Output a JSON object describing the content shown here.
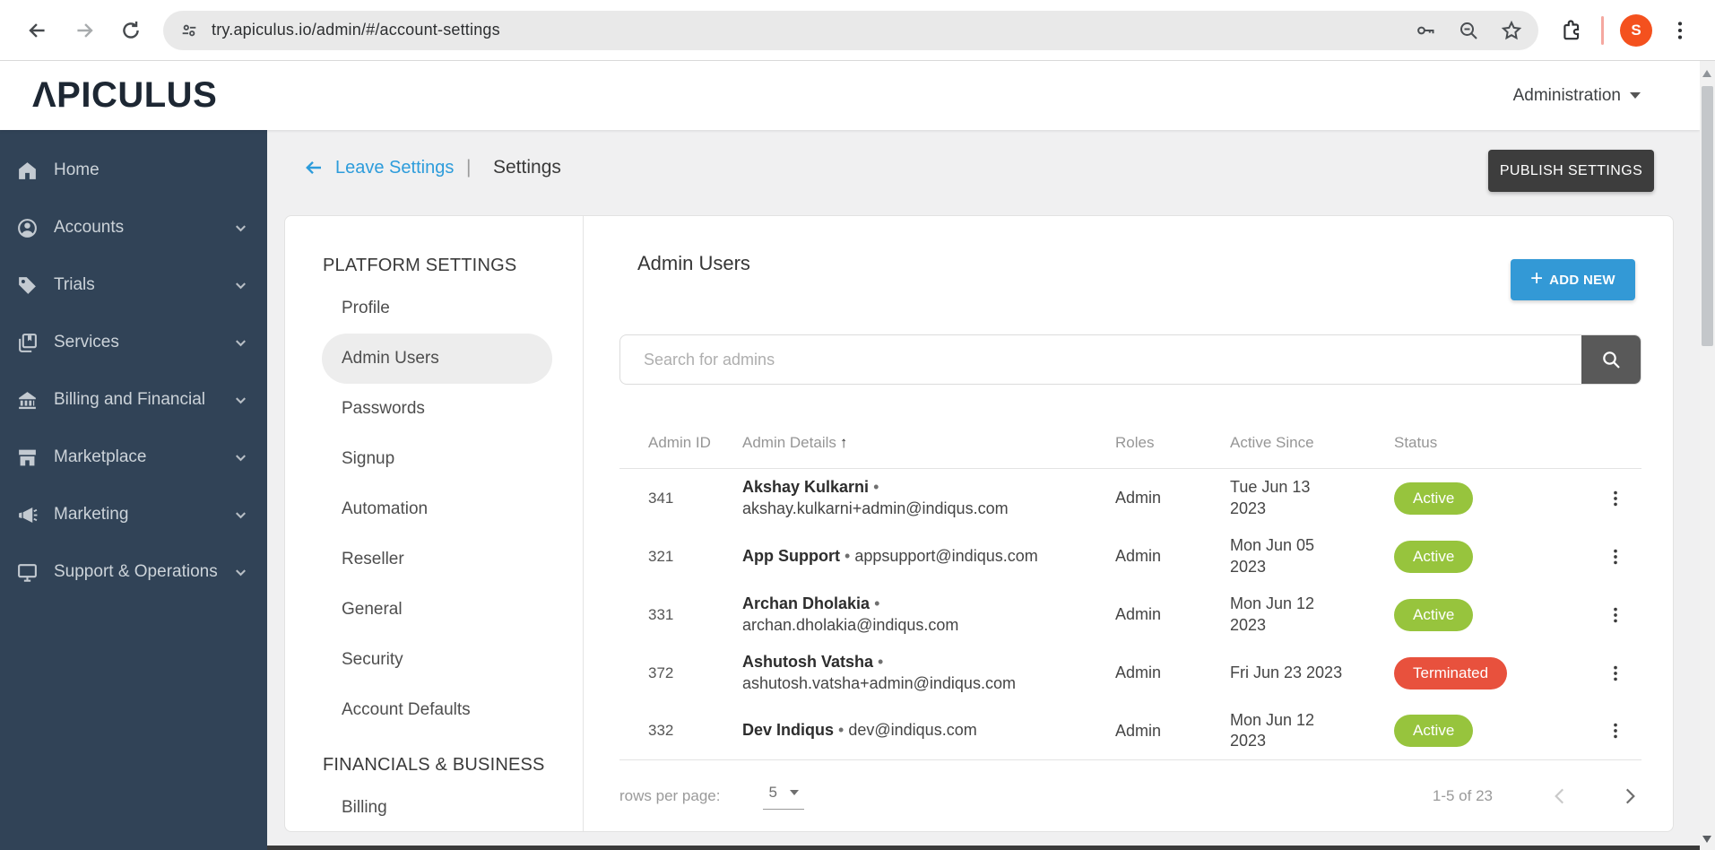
{
  "browser": {
    "url": "try.apiculus.io/admin/#/account-settings",
    "avatar_initial": "S"
  },
  "header": {
    "logo_text": "ΛPICULUS",
    "account_menu_label": "Administration"
  },
  "sidebar": {
    "items": [
      {
        "label": "Home",
        "icon": "home-icon",
        "chevron": false
      },
      {
        "label": "Accounts",
        "icon": "accounts-icon",
        "chevron": true
      },
      {
        "label": "Trials",
        "icon": "trials-icon",
        "chevron": true
      },
      {
        "label": "Services",
        "icon": "services-icon",
        "chevron": true
      },
      {
        "label": "Billing and Financial",
        "icon": "billing-icon",
        "chevron": true
      },
      {
        "label": "Marketplace",
        "icon": "marketplace-icon",
        "chevron": true
      },
      {
        "label": "Marketing",
        "icon": "marketing-icon",
        "chevron": true
      },
      {
        "label": "Support & Operations",
        "icon": "support-icon",
        "chevron": true
      }
    ]
  },
  "toolbar": {
    "back_link_label": "Leave Settings",
    "separator": "|",
    "page_title": "Settings",
    "publish_label": "PUBLISH SETTINGS"
  },
  "settings_nav": {
    "active_item": "Admin Users",
    "sections": [
      {
        "title": "PLATFORM SETTINGS",
        "items": [
          "Profile",
          "Admin Users",
          "Passwords",
          "Signup",
          "Automation",
          "Reseller",
          "General",
          "Security",
          "Account Defaults"
        ]
      },
      {
        "title": "FINANCIALS & BUSINESS",
        "items": [
          "Billing"
        ]
      }
    ]
  },
  "admin_users": {
    "title": "Admin Users",
    "add_button_plus": "+",
    "add_button_label": "ADD NEW",
    "search_placeholder": "Search for admins",
    "columns": [
      "Admin ID",
      "Admin Details",
      "Roles",
      "Active Since",
      "Status"
    ],
    "sort_column": "Admin Details",
    "sort_direction": "asc",
    "name_separator": "•",
    "rows": [
      {
        "id": "341",
        "name": "Akshay Kulkarni",
        "email": "akshay.kulkarni+admin@indiqus.com",
        "role": "Admin",
        "active_since": "Tue Jun 13 2023",
        "status": "Active"
      },
      {
        "id": "321",
        "name": "App Support",
        "email": "appsupport@indiqus.com",
        "role": "Admin",
        "active_since": "Mon Jun 05 2023",
        "status": "Active"
      },
      {
        "id": "331",
        "name": "Archan Dholakia",
        "email": "archan.dholakia@indiqus.com",
        "role": "Admin",
        "active_since": "Mon Jun 12 2023",
        "status": "Active"
      },
      {
        "id": "372",
        "name": "Ashutosh Vatsha",
        "email": "ashutosh.vatsha+admin@indiqus.com",
        "role": "Admin",
        "active_since": "Fri Jun 23 2023",
        "status": "Terminated"
      },
      {
        "id": "332",
        "name": "Dev Indiqus",
        "email": "dev@indiqus.com",
        "role": "Admin",
        "active_since": "Mon Jun 12 2023",
        "status": "Active"
      }
    ],
    "pagination": {
      "rows_per_page_label": "rows per page:",
      "rows_per_page": "5",
      "range_label": "1-5 of 23"
    }
  },
  "colors": {
    "accent_blue": "#3399d6",
    "link_blue": "#2d9cdb",
    "status_active": "#97c43d",
    "status_terminated": "#e8513d",
    "sidebar_bg": "#314357",
    "publish_button": "#3d3d3d",
    "avatar_bg": "#f4511e"
  }
}
